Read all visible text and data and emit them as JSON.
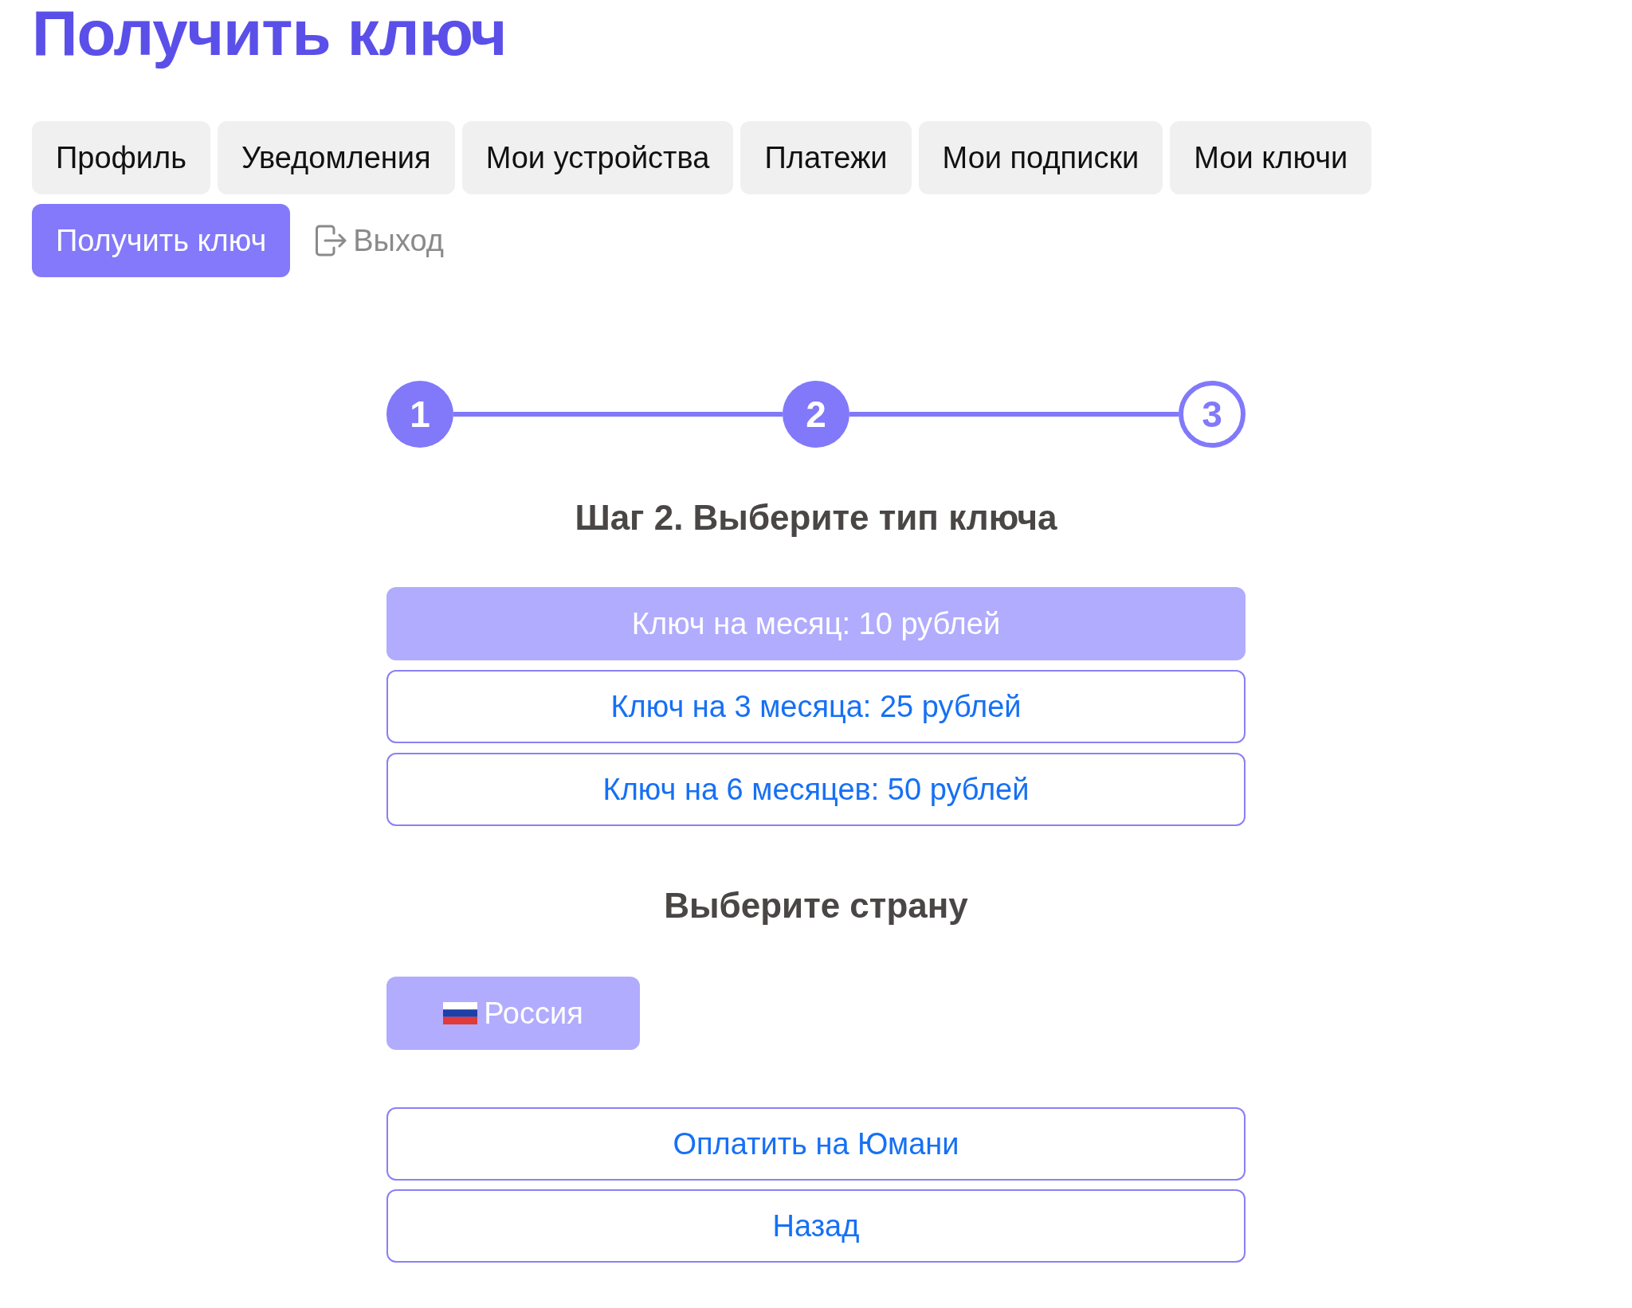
{
  "title": "Получить ключ",
  "nav": {
    "tabs": [
      {
        "label": "Профиль",
        "selected": false
      },
      {
        "label": "Уведомления",
        "selected": false
      },
      {
        "label": "Мои устройства",
        "selected": false
      },
      {
        "label": "Платежи",
        "selected": false
      },
      {
        "label": "Мои подписки",
        "selected": false
      },
      {
        "label": "Мои ключи",
        "selected": false
      },
      {
        "label": "Получить ключ",
        "selected": true
      }
    ],
    "logout": "Выход"
  },
  "stepper": {
    "steps": [
      {
        "label": "1",
        "active": true
      },
      {
        "label": "2",
        "active": true
      },
      {
        "label": "3",
        "active": false
      }
    ]
  },
  "step_heading": "Шаг 2. Выберите тип ключа",
  "key_options": [
    {
      "label": "Ключ на месяц: 10 рублей",
      "selected": true
    },
    {
      "label": "Ключ на 3 месяца: 25 рублей",
      "selected": false
    },
    {
      "label": "Ключ на 6 месяцев: 50 рублей",
      "selected": false
    }
  ],
  "country_heading": "Выберите страну",
  "countries": [
    {
      "label": "Россия",
      "selected": true
    }
  ],
  "actions": {
    "pay": "Оплатить на Юмани",
    "back": "Назад"
  }
}
